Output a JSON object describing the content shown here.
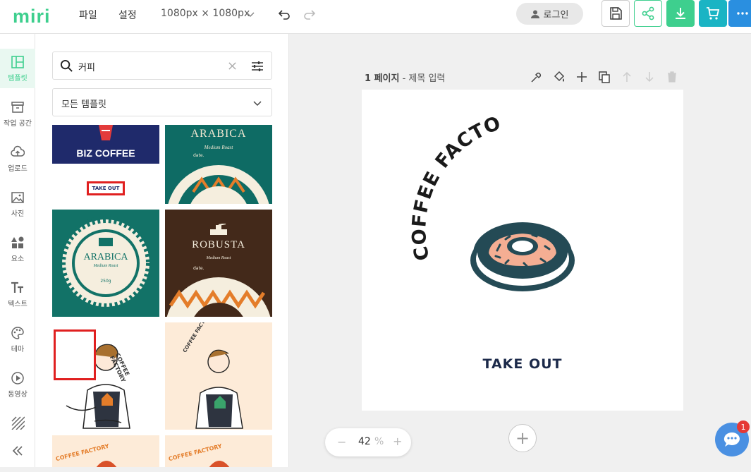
{
  "app": {
    "logo": "miri"
  },
  "menu": {
    "file": "파일",
    "settings": "설정",
    "canvas_size": "1080px × 1080px"
  },
  "header": {
    "login": "로그인"
  },
  "sidebar": {
    "items": [
      {
        "label": "템플릿",
        "icon": "template-icon",
        "active": true
      },
      {
        "label": "작업 공간",
        "icon": "archive-icon"
      },
      {
        "label": "업로드",
        "icon": "upload-icon"
      },
      {
        "label": "사진",
        "icon": "photo-icon"
      },
      {
        "label": "요소",
        "icon": "shapes-icon"
      },
      {
        "label": "텍스트",
        "icon": "text-icon"
      },
      {
        "label": "테마",
        "icon": "palette-icon"
      },
      {
        "label": "동영상",
        "icon": "video-icon"
      },
      {
        "label": "",
        "icon": "pattern-icon"
      },
      {
        "label": "",
        "icon": "collapse-icon"
      }
    ]
  },
  "panel": {
    "search_value": "커피",
    "filter": "모든 템플릿",
    "templates": [
      {
        "title": "BIZ COFFEE",
        "subtitle": "TAKE OUT"
      },
      {
        "title": "ARABICA",
        "subtitle": "Medium Roast",
        "extra": "date."
      },
      {
        "title": "ARABICA",
        "subtitle": "Medium Roast",
        "extra": "250g"
      },
      {
        "title": "ROBUSTA",
        "subtitle": "Medium Roast",
        "extra": "date."
      },
      {
        "title": "COFFEE FACTORY"
      },
      {
        "title": "COFFEE FACTORY"
      },
      {
        "title": "COFFEE FACTORY"
      },
      {
        "title": "COFFEE FACTORY"
      }
    ]
  },
  "canvas": {
    "page_number": "1 페이지",
    "page_title_placeholder": "- 제목 입력",
    "curved_text": "COFFEE FACTORY",
    "take_out": "TAKE OUT",
    "zoom_value": "42",
    "zoom_unit": "%",
    "add_page": "+"
  },
  "chat": {
    "badge": "1"
  },
  "colors": {
    "accent": "#3ecf8e",
    "teal": "#1ab4c4",
    "donut_dark": "#244a55",
    "donut_pink": "#f4ae93",
    "take_out": "#1c2a4a",
    "highlight": "#e02020"
  }
}
